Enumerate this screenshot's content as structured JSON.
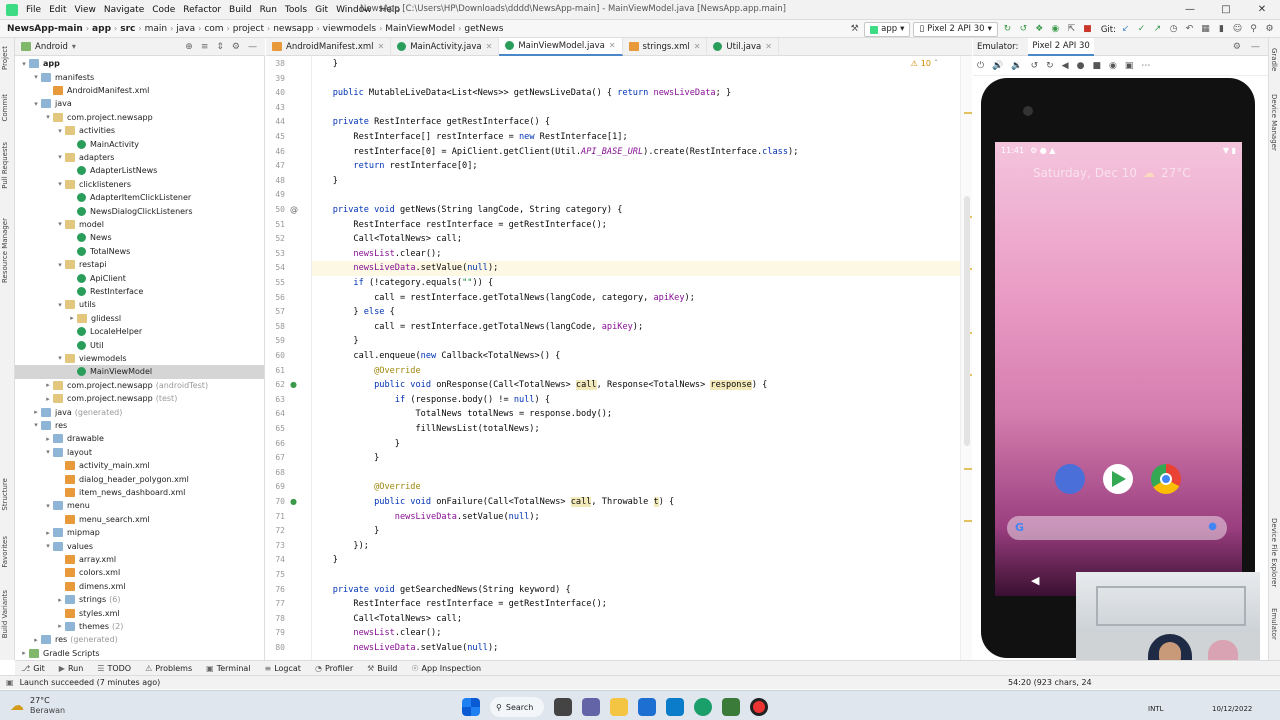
{
  "menubar": {
    "items": [
      "File",
      "Edit",
      "View",
      "Navigate",
      "Code",
      "Refactor",
      "Build",
      "Run",
      "Tools",
      "Git",
      "Window",
      "Help"
    ],
    "window_title": "NewsApp [C:\\Users\\HP\\Downloads\\dddd\\NewsApp-main] - MainViewModel.java [NewsApp.app.main]"
  },
  "navbar": {
    "breadcrumbs": [
      "NewsApp-main",
      "app",
      "src",
      "main",
      "java",
      "com",
      "project",
      "newsapp",
      "viewmodels",
      "MainViewModel",
      "getNews"
    ],
    "run_config": "app",
    "device": "Pixel 2 API 30",
    "git_label": "Git:"
  },
  "left_strip": [
    "Project",
    "Commit",
    "Pull Requests",
    "Resource Manager",
    "Structure",
    "Favorites",
    "Build Variants"
  ],
  "right_strip": [
    "Gradle",
    "Device Manager",
    "Device File Explorer",
    "Emulator"
  ],
  "project_panel": {
    "view": "Android",
    "tree": [
      {
        "label": "app",
        "depth": 0,
        "icon": "folder",
        "open": true,
        "bold": true
      },
      {
        "label": "manifests",
        "depth": 1,
        "icon": "folder",
        "open": true
      },
      {
        "label": "AndroidManifest.xml",
        "depth": 2,
        "icon": "xml"
      },
      {
        "label": "java",
        "depth": 1,
        "icon": "folder",
        "open": true
      },
      {
        "label": "com.project.newsapp",
        "depth": 2,
        "icon": "fold2",
        "open": true
      },
      {
        "label": "activities",
        "depth": 3,
        "icon": "fold2",
        "open": true
      },
      {
        "label": "MainActivity",
        "depth": 4,
        "icon": "cls"
      },
      {
        "label": "adapters",
        "depth": 3,
        "icon": "fold2",
        "open": true
      },
      {
        "label": "AdapterListNews",
        "depth": 4,
        "icon": "cls"
      },
      {
        "label": "clicklisteners",
        "depth": 3,
        "icon": "fold2",
        "open": true
      },
      {
        "label": "AdapterItemClickListener",
        "depth": 4,
        "icon": "cls"
      },
      {
        "label": "NewsDialogClickListeners",
        "depth": 4,
        "icon": "cls"
      },
      {
        "label": "model",
        "depth": 3,
        "icon": "fold2",
        "open": true
      },
      {
        "label": "News",
        "depth": 4,
        "icon": "cls"
      },
      {
        "label": "TotalNews",
        "depth": 4,
        "icon": "cls"
      },
      {
        "label": "restapi",
        "depth": 3,
        "icon": "fold2",
        "open": true
      },
      {
        "label": "ApiClient",
        "depth": 4,
        "icon": "cls"
      },
      {
        "label": "RestInterface",
        "depth": 4,
        "icon": "cls"
      },
      {
        "label": "utils",
        "depth": 3,
        "icon": "fold2",
        "open": true
      },
      {
        "label": "glidessl",
        "depth": 4,
        "icon": "fold2",
        "open": false
      },
      {
        "label": "LocaleHelper",
        "depth": 4,
        "icon": "cls"
      },
      {
        "label": "Util",
        "depth": 4,
        "icon": "cls"
      },
      {
        "label": "viewmodels",
        "depth": 3,
        "icon": "fold2",
        "open": true
      },
      {
        "label": "MainViewModel",
        "depth": 4,
        "icon": "cls",
        "selected": true
      },
      {
        "label": "com.project.newsapp",
        "depth": 2,
        "icon": "fold2",
        "open": false,
        "suffix": "(androidTest)"
      },
      {
        "label": "com.project.newsapp",
        "depth": 2,
        "icon": "fold2",
        "open": false,
        "suffix": "(test)"
      },
      {
        "label": "java",
        "depth": 1,
        "icon": "folder",
        "open": false,
        "suffix": "(generated)"
      },
      {
        "label": "res",
        "depth": 1,
        "icon": "folder",
        "open": true
      },
      {
        "label": "drawable",
        "depth": 2,
        "icon": "folder",
        "open": false
      },
      {
        "label": "layout",
        "depth": 2,
        "icon": "folder",
        "open": true
      },
      {
        "label": "activity_main.xml",
        "depth": 3,
        "icon": "xml"
      },
      {
        "label": "dialog_header_polygon.xml",
        "depth": 3,
        "icon": "xml"
      },
      {
        "label": "item_news_dashboard.xml",
        "depth": 3,
        "icon": "xml"
      },
      {
        "label": "menu",
        "depth": 2,
        "icon": "folder",
        "open": true
      },
      {
        "label": "menu_search.xml",
        "depth": 3,
        "icon": "xml"
      },
      {
        "label": "mipmap",
        "depth": 2,
        "icon": "folder",
        "open": false
      },
      {
        "label": "values",
        "depth": 2,
        "icon": "folder",
        "open": true
      },
      {
        "label": "array.xml",
        "depth": 3,
        "icon": "xml"
      },
      {
        "label": "colors.xml",
        "depth": 3,
        "icon": "xml"
      },
      {
        "label": "dimens.xml",
        "depth": 3,
        "icon": "xml"
      },
      {
        "label": "strings",
        "depth": 3,
        "icon": "folder",
        "open": false,
        "suffix": "(6)"
      },
      {
        "label": "styles.xml",
        "depth": 3,
        "icon": "xml"
      },
      {
        "label": "themes",
        "depth": 3,
        "icon": "folder",
        "open": false,
        "suffix": "(2)"
      },
      {
        "label": "res",
        "depth": 1,
        "icon": "folder",
        "open": false,
        "suffix": "(generated)"
      },
      {
        "label": "Gradle Scripts",
        "depth": 0,
        "icon": "and",
        "open": false
      }
    ]
  },
  "editor": {
    "tabs": [
      {
        "label": "AndroidManifest.xml",
        "icon": "xml"
      },
      {
        "label": "MainActivity.java",
        "icon": "cls"
      },
      {
        "label": "MainViewModel.java",
        "icon": "cls",
        "active": true
      },
      {
        "label": "strings.xml",
        "icon": "xml"
      },
      {
        "label": "Util.java",
        "icon": "cls"
      }
    ],
    "warnings": "10",
    "lines": [
      {
        "n": "38",
        "html": "    }"
      },
      {
        "n": "39",
        "html": ""
      },
      {
        "n": "40",
        "html": "    <span class=\"kw\">public</span> MutableLiveData&lt;List&lt;News&gt;&gt; getNewsLiveData() { <span class=\"kw\">return</span> <span class=\"fld\">newsLiveData</span>; }"
      },
      {
        "n": "43",
        "html": ""
      },
      {
        "n": "44",
        "html": "    <span class=\"kw\">private</span> RestInterface getRestInterface() {"
      },
      {
        "n": "45",
        "html": "        RestInterface[] restInterface = <span class=\"kw\">new</span> RestInterface[1];"
      },
      {
        "n": "46",
        "html": "        restInterface[0] = ApiClient.getClient(Util.<span class=\"ital\">API_BASE_URL</span>).create(RestInterface.<span class=\"kw\">class</span>);"
      },
      {
        "n": "47",
        "html": "        <span class=\"kw\">return</span> restInterface[0];"
      },
      {
        "n": "48",
        "html": "    }"
      },
      {
        "n": "49",
        "html": ""
      },
      {
        "n": "50",
        "html": "    <span class=\"kw\">private void</span> getNews(String langCode, String category) {"
      },
      {
        "n": "51",
        "html": "        RestInterface restInterface = getRestInterface();"
      },
      {
        "n": "52",
        "html": "        Call&lt;TotalNews&gt; call;"
      },
      {
        "n": "53",
        "html": "        <span class=\"fld\">newsList</span>.clear();"
      },
      {
        "n": "54",
        "html": "        <span class=\"fld\">newsLiveData</span>.setValue(<span class=\"kw\">null</span>);",
        "hl": true
      },
      {
        "n": "55",
        "html": "        <span class=\"kw\">if</span> (!category.equals(<span class=\"str\">\"\"</span>)) {"
      },
      {
        "n": "56",
        "html": "            call = restInterface.getTotalNews(langCode, category, <span class=\"fld\">apiKey</span>);"
      },
      {
        "n": "57",
        "html": "        } <span class=\"kw\">else</span> {"
      },
      {
        "n": "58",
        "html": "            call = restInterface.getTotalNews(langCode, <span class=\"fld\">apiKey</span>);"
      },
      {
        "n": "59",
        "html": "        }"
      },
      {
        "n": "60",
        "html": "        call.enqueue(<span class=\"kw\">new</span> Callback&lt;TotalNews&gt;() {"
      },
      {
        "n": "61",
        "html": "            <span class=\"ann\">@Override</span>"
      },
      {
        "n": "62",
        "html": "            <span class=\"kw\">public void</span> onResponse(Call&lt;TotalNews&gt; <span class=\"param\">call</span>, Response&lt;TotalNews&gt; <span class=\"param\">response</span>) {"
      },
      {
        "n": "63",
        "html": "                <span class=\"kw\">if</span> (response.body() != <span class=\"kw\">null</span>) {"
      },
      {
        "n": "64",
        "html": "                    TotalNews totalNews = response.body();"
      },
      {
        "n": "65",
        "html": "                    fillNewsList(totalNews);"
      },
      {
        "n": "66",
        "html": "                }"
      },
      {
        "n": "67",
        "html": "            }"
      },
      {
        "n": "68",
        "html": ""
      },
      {
        "n": "69",
        "html": "            <span class=\"ann\">@Override</span>"
      },
      {
        "n": "70",
        "html": "            <span class=\"kw\">public void</span> onFailure(Call&lt;TotalNews&gt; <span class=\"param\">call</span>, Throwable <span class=\"param\">t</span>) {"
      },
      {
        "n": "71",
        "html": "                <span class=\"fld\">newsLiveData</span>.setValue(<span class=\"kw\">null</span>);"
      },
      {
        "n": "72",
        "html": "            }"
      },
      {
        "n": "73",
        "html": "        });"
      },
      {
        "n": "74",
        "html": "    }"
      },
      {
        "n": "75",
        "html": ""
      },
      {
        "n": "76",
        "html": "    <span class=\"kw\">private void</span> getSearchedNews(String keyword) {"
      },
      {
        "n": "77",
        "html": "        RestInterface restInterface = getRestInterface();"
      },
      {
        "n": "78",
        "html": "        Call&lt;TotalNews&gt; call;"
      },
      {
        "n": "79",
        "html": "        <span class=\"fld\">newsList</span>.clear();"
      },
      {
        "n": "80",
        "html": "        <span class=\"fld\">newsLiveData</span>.setValue(<span class=\"kw\">null</span>);"
      }
    ]
  },
  "emulator": {
    "title": "Emulator:",
    "tab": "Pixel 2 API 30",
    "status_time": "11:41",
    "date_text": "Saturday, Dec 10",
    "temp": "27°C"
  },
  "bottom_tools": [
    "Git",
    "Run",
    "TODO",
    "Problems",
    "Terminal",
    "Logcat",
    "Profiler",
    "Build",
    "App Inspection"
  ],
  "status": {
    "message": "Launch succeeded (7 minutes ago)",
    "position": "54:20 (923 chars, 24"
  },
  "taskbar": {
    "weather_temp": "27°C",
    "weather_desc": "Berawan",
    "search": "Search",
    "lang": "INTL",
    "date": "10/12/2022"
  }
}
